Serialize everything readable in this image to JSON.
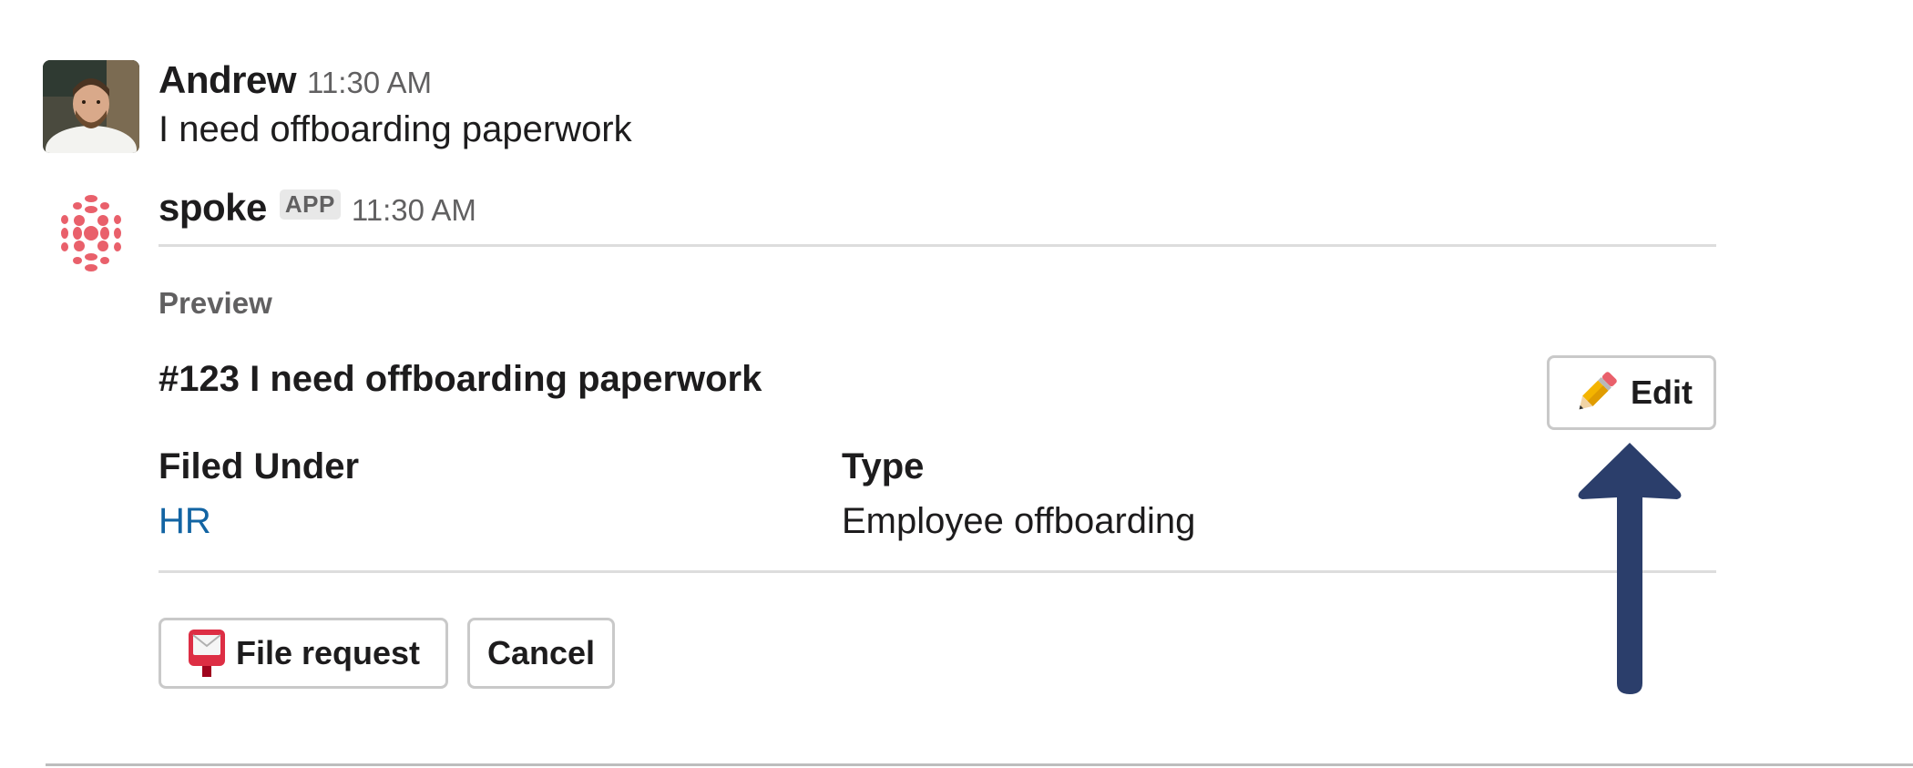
{
  "messages": [
    {
      "sender": "Andrew",
      "time": "11:30 AM",
      "text": "I need offboarding paperwork",
      "avatar_icon": "user-photo"
    },
    {
      "sender": "spoke",
      "badge": "APP",
      "time": "11:30 AM",
      "avatar_icon": "spoke-logo-icon",
      "accent_color": "#e9606b"
    }
  ],
  "preview": {
    "label": "Preview",
    "ticket_title": "#123 I need offboarding paperwork",
    "edit_button": {
      "label": "Edit",
      "icon": "pencil-icon"
    },
    "fields": [
      {
        "label": "Filed Under",
        "value": "HR",
        "is_link": true
      },
      {
        "label": "Type",
        "value": "Employee offboarding",
        "is_link": false
      }
    ]
  },
  "actions": {
    "file_request": {
      "label": "File request",
      "icon": "postbox-icon"
    },
    "cancel": {
      "label": "Cancel"
    }
  },
  "annotation": {
    "icon": "up-arrow-icon",
    "color": "#2b3e6b"
  },
  "colors": {
    "link": "#1264a3",
    "muted": "#616061",
    "border": "#c9c9c9"
  }
}
